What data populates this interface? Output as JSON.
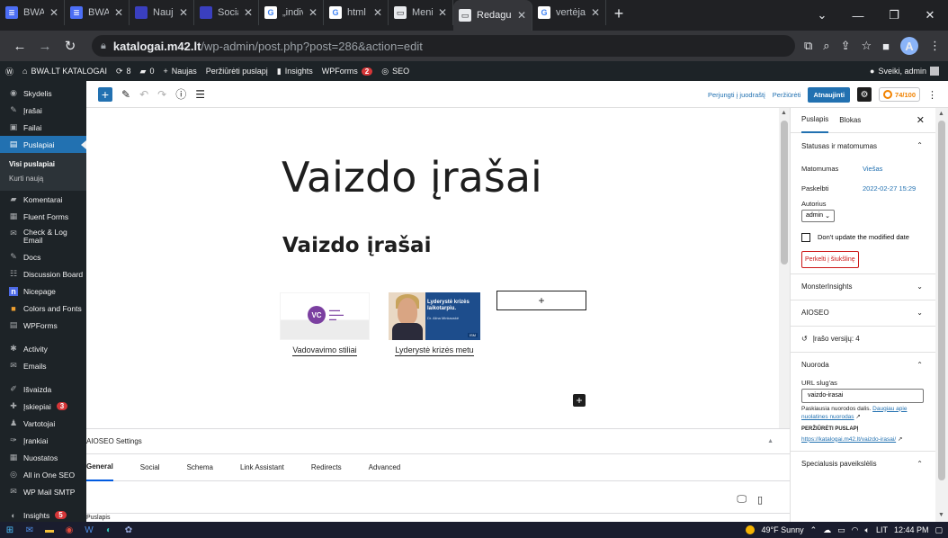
{
  "browser": {
    "tabs": [
      {
        "label": "BWA.LT -",
        "favicon_color": "#4c6ef5",
        "favicon_glyph": "≣"
      },
      {
        "label": "BWA.LT",
        "favicon_color": "#4c6ef5",
        "favicon_glyph": "≣"
      },
      {
        "label": "Naujienos",
        "favicon_color": "#3a3fbf",
        "favicon_glyph": ""
      },
      {
        "label": "Socialinis",
        "favicon_color": "#3a3fbf",
        "favicon_glyph": ""
      },
      {
        "label": "„individu",
        "favicon_color": "#ffffff",
        "favicon_glyph": "G"
      },
      {
        "label": "html pictu",
        "favicon_color": "#ffffff",
        "favicon_glyph": "G"
      },
      {
        "label": "Meniu ‹ B",
        "favicon_color": "#e8eaed",
        "favicon_glyph": "▭"
      },
      {
        "label": "Redaguoti",
        "favicon_color": "#e8eaed",
        "favicon_glyph": "▭",
        "active": true
      },
      {
        "label": "vertėjas -",
        "favicon_color": "#ffffff",
        "favicon_glyph": "G"
      }
    ],
    "new_tab": "+",
    "url_host": "katalogai.m42.lt",
    "url_path": "/wp-admin/post.php?post=286&action=edit",
    "profile_initial": "A"
  },
  "adminbar": {
    "site": "BWA.LT KATALOGAI",
    "updates": "8",
    "comments": "0",
    "new": "Naujas",
    "view_page": "Peržiūrėti puslapį",
    "insights": "Insights",
    "wpforms": "WPForms",
    "wpforms_count": "2",
    "seo": "SEO",
    "howdy": "Sveiki, admin"
  },
  "menu": {
    "items": [
      {
        "label": "Skydelis",
        "icon": "dashboard-icon",
        "glyph": "◉"
      },
      {
        "label": "Įrašai",
        "icon": "pin-icon",
        "glyph": "✎"
      },
      {
        "label": "Failai",
        "icon": "media-icon",
        "glyph": "▣"
      },
      {
        "label": "Puslapiai",
        "icon": "pages-icon",
        "glyph": "▤",
        "current": true
      }
    ],
    "submenu": [
      "Visi puslapiai",
      "Kurti naują"
    ],
    "items2": [
      {
        "label": "Komentarai",
        "icon": "comments-icon",
        "glyph": "▰"
      },
      {
        "label": "Fluent Forms",
        "icon": "forms-icon",
        "glyph": "▦"
      },
      {
        "label": "Check & Log Email",
        "icon": "mail-icon",
        "glyph": "✉"
      },
      {
        "label": "Docs",
        "icon": "docs-icon",
        "glyph": "✎"
      },
      {
        "label": "Discussion Board",
        "icon": "board-icon",
        "glyph": "☷"
      },
      {
        "label": "Nicepage",
        "icon": "nicepage-icon",
        "glyph": "n"
      },
      {
        "label": "Colors and Fonts",
        "icon": "palette-icon",
        "glyph": "■"
      },
      {
        "label": "WPForms",
        "icon": "wpforms-icon",
        "glyph": "▤"
      }
    ],
    "items3": [
      {
        "label": "Activity",
        "icon": "activity-icon",
        "glyph": "✱"
      },
      {
        "label": "Emails",
        "icon": "emails-icon",
        "glyph": "✉"
      }
    ],
    "items4": [
      {
        "label": "Išvaizda",
        "icon": "appearance-icon",
        "glyph": "✐"
      },
      {
        "label": "Įskiepiai",
        "icon": "plugins-icon",
        "glyph": "✚",
        "badge": "3"
      },
      {
        "label": "Vartotojai",
        "icon": "users-icon",
        "glyph": "♟"
      },
      {
        "label": "Įrankiai",
        "icon": "tools-icon",
        "glyph": "✑"
      },
      {
        "label": "Nuostatos",
        "icon": "settings-icon",
        "glyph": "▦"
      },
      {
        "label": "All in One SEO",
        "icon": "aioseo-icon",
        "glyph": "◎"
      },
      {
        "label": "WP Mail SMTP",
        "icon": "smtp-icon",
        "glyph": "✉"
      }
    ],
    "items5": [
      {
        "label": "Insights",
        "icon": "insights-icon",
        "glyph": "◐",
        "badge": "5"
      }
    ]
  },
  "editor": {
    "switch_draft": "Perjungti į juodraštį",
    "preview": "Peržiūrėti",
    "update": "Atnaujinti",
    "score": "74/100"
  },
  "content": {
    "title": "Vaizdo įrašai",
    "heading": "Vaizdo įrašai",
    "gallery": [
      {
        "caption": "Vadovavimo stiliai"
      },
      {
        "caption": "Lyderystė krizės metu",
        "thumb_title": "Lyderystė krizės laikotarpiu.",
        "thumb_name": "Dr. Alina Minkauskė"
      }
    ],
    "add_slot": "+"
  },
  "aioseo": {
    "title": "AIOSEO Settings",
    "tabs": [
      "General",
      "Social",
      "Schema",
      "Link Assistant",
      "Redirects",
      "Advanced"
    ]
  },
  "breadcrumb": "Puslapis",
  "sidebar": {
    "tabs": [
      "Puslapis",
      "Blokas"
    ],
    "status_title": "Statusas ir matomumas",
    "visibility_label": "Matomumas",
    "visibility_value": "Viešas",
    "published_label": "Paskelbti",
    "published_value": "2022-02-27 15:29",
    "author_label": "Autorius",
    "author_value": "admin",
    "dont_update": "Don't update the modified date",
    "trash": "Perkelti į šiukšlinę",
    "monsterinsights": "MonsterInsights",
    "aioseo": "AIOSEO",
    "revisions": "Įrašo versijų: 4",
    "link_title": "Nuoroda",
    "slug_label": "URL slug'as",
    "slug_value": "vaizdo-irasai",
    "slug_help": "Paskiausia nuorodos dalis.",
    "slug_help_link": "Daugiau apie nuolatines nuorodas",
    "view_page_caps": "PERŽIŪRĖTI PUSLAPĮ",
    "permalink": "https://katalogai.m42.lt/vaizdo-irasai/",
    "featured": "Specialusis paveikslėlis"
  },
  "taskbar": {
    "weather": "49°F  Sunny",
    "lang": "LIT",
    "time": "12:44 PM"
  },
  "colors": {
    "wp_blue": "#2271b1",
    "admin_dark": "#1d2327",
    "danger": "#d63638"
  }
}
